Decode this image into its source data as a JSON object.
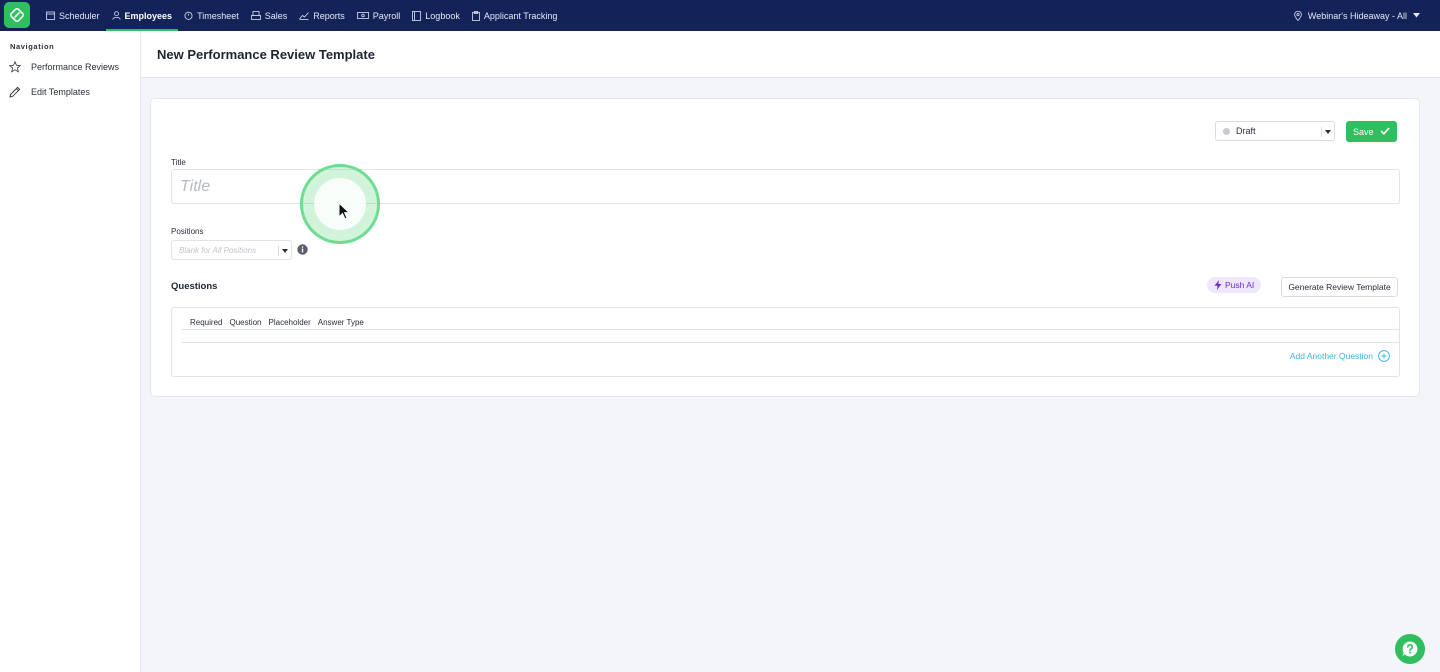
{
  "nav": {
    "items": [
      {
        "label": "Scheduler",
        "icon": "calendar-icon"
      },
      {
        "label": "Employees",
        "icon": "person-icon",
        "active": true
      },
      {
        "label": "Timesheet",
        "icon": "clock-icon"
      },
      {
        "label": "Sales",
        "icon": "register-icon"
      },
      {
        "label": "Reports",
        "icon": "chart-icon"
      },
      {
        "label": "Payroll",
        "icon": "money-icon"
      },
      {
        "label": "Logbook",
        "icon": "book-icon"
      },
      {
        "label": "Applicant Tracking",
        "icon": "clipboard-icon"
      }
    ],
    "location": "Webinar's Hideaway - All"
  },
  "sidebar": {
    "heading": "Navigation",
    "items": [
      {
        "label": "Performance Reviews",
        "icon": "star-icon"
      },
      {
        "label": "Edit Templates",
        "icon": "pencil-icon"
      }
    ]
  },
  "page": {
    "title": "New Performance Review Template"
  },
  "form": {
    "status": "Draft",
    "save_label": "Save",
    "title_label": "Title",
    "title_placeholder": "Title",
    "positions_label": "Positions",
    "positions_placeholder": "Blank for All Positions",
    "questions_label": "Questions",
    "push_ai_label": "Push AI",
    "generate_label": "Generate Review Template",
    "columns": [
      "Required",
      "Question",
      "Placeholder",
      "Answer Type"
    ],
    "add_question_label": "Add Another Question"
  },
  "colors": {
    "nav_bg": "#13235a",
    "accent_green": "#2fbf5e",
    "link_blue": "#3ab3e0",
    "ai_purple": "#6a2fc4"
  }
}
